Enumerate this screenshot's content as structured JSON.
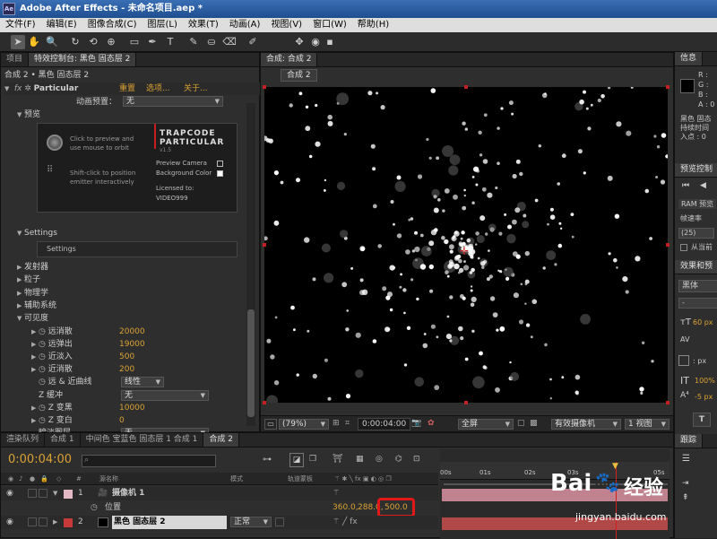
{
  "window": {
    "app_icon": "Ae",
    "title": "Adobe After Effects - 未命名项目.aep *"
  },
  "menu": [
    "文件(F)",
    "编辑(E)",
    "图像合成(C)",
    "图层(L)",
    "效果(T)",
    "动画(A)",
    "视图(V)",
    "窗口(W)",
    "帮助(H)"
  ],
  "toolbar": {
    "tools": [
      "selection-icon",
      "hand-icon",
      "zoom-icon",
      "rotate-icon",
      "camera-orbit-icon",
      "pan-behind-icon",
      "rectangle-mask-icon",
      "pen-icon",
      "text-icon",
      "brush-icon",
      "clone-stamp-icon",
      "eraser-icon",
      "roto-brush-icon",
      "puppet-pin-icon"
    ]
  },
  "left_panel": {
    "tabs": [
      "项目",
      "特效控制台: 黑色 固态层 2"
    ],
    "breadcrumb": "合成 2 • 黑色 固态层 2",
    "effect": {
      "fx": "fx",
      "name": "Particular",
      "reset": "重置",
      "options": "选项...",
      "about": "关于..."
    },
    "anim_preset": {
      "label": "动画预置：",
      "value": "无"
    },
    "preview": {
      "label": "预览",
      "hint1": "Click to preview and use mouse to orbit",
      "hint2": "Shift-click to position emitter interactively",
      "logo1": "TRAPCODE",
      "logo2": "PARTICULAR",
      "version": "v1.5",
      "preview_camera": "Preview Camera",
      "background_color": "Background Color",
      "licensed": "Licensed to:",
      "licensee": "VIDEO999"
    },
    "settings": {
      "label": "Settings",
      "button": "Settings"
    },
    "groups": [
      "发射器",
      "粒子",
      "物理学",
      "辅助系统"
    ],
    "visibility": {
      "label": "可见度",
      "rows": [
        {
          "name": "远消散",
          "value": "20000"
        },
        {
          "name": "远弹出",
          "value": "19000"
        },
        {
          "name": "近淡入",
          "value": "500"
        },
        {
          "name": "近消散",
          "value": "200"
        }
      ],
      "curve": {
        "name": "远 & 近曲线",
        "value": "线性"
      },
      "zbuffer": {
        "name": "Z 缓冲",
        "value": "无"
      },
      "zblack": {
        "name": "Z 变黑",
        "value": "10000"
      },
      "zwhite": {
        "name": "Z 变白",
        "value": "0"
      },
      "blend": {
        "name": "暗淡图层",
        "value": "无"
      },
      "partial": {
        "name": "暗淡图层..."
      }
    }
  },
  "comp_panel": {
    "tab": "合成: 合成 2",
    "sub_tab": "合成 2",
    "zoom": "(79%)",
    "time": "0:00:04:00",
    "resolution": "全屏",
    "camera": "有效摄像机",
    "views": "1 视图"
  },
  "right_panel": {
    "info_tab": "信息",
    "rgb": [
      "R :",
      "G :",
      "B :",
      "A : 0"
    ],
    "layer_info": [
      "黑色 固态",
      "持续时间",
      "入点 : 0"
    ],
    "preview_tab": "预览控制",
    "ram": "RAM 预览",
    "fps_label": "帧速率",
    "fps": "(25)",
    "from_current": "从当前",
    "effects_tab": "效果和预",
    "font": "黑体",
    "font_size": "60 px",
    "tracking_label": ": px",
    "scale": "100%",
    "baseline": "-5 px",
    "T_label": "T",
    "paragraph_tab": "跟踪"
  },
  "timeline": {
    "tabs": [
      "渲染队列",
      "合成 1",
      "中间色 宝蓝色 固态层 1 合成 1",
      "合成 2"
    ],
    "time": "0:00:04:00",
    "search_placeholder": "",
    "col_index": "#",
    "col_name": "源名称",
    "col_mode": "模式",
    "col_trkmat": "轨道蒙板",
    "ruler": [
      "00s",
      "01s",
      "02s",
      "03s",
      "05s"
    ],
    "layers": [
      {
        "index": "1",
        "name": "摄像机 1",
        "color": "#e5b8c5"
      },
      {
        "index": "2",
        "name": "黑色 固态层 2",
        "color": "#c83a3a",
        "mode": "正常"
      }
    ],
    "position": {
      "label": "位置",
      "x": "360.0,",
      "y": "288.0,",
      "z": "500.0"
    }
  },
  "watermark": {
    "brand": "Bai",
    "paw": "du",
    "text": "经验",
    "url": "jingyan.baidu.com"
  },
  "colors": {
    "accent": "#d9a233",
    "titlebar": "#2a5c9f",
    "highlight": "#e01818"
  }
}
